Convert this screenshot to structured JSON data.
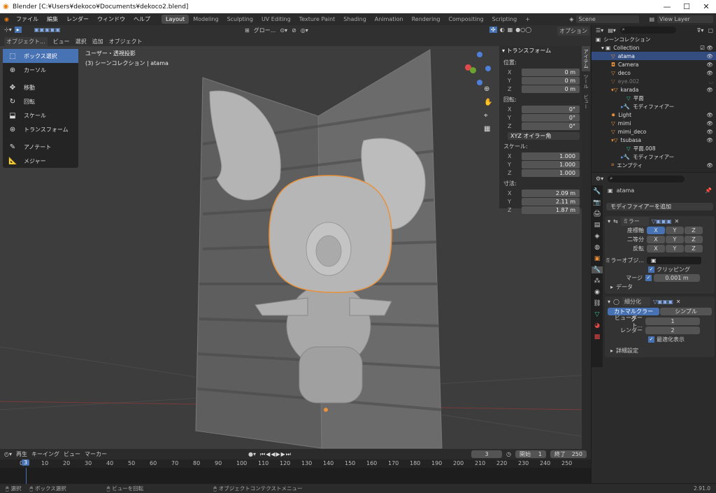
{
  "window": {
    "title": "Blender [C:¥Users¥dekoco¥Documents¥dekoco2.blend]"
  },
  "menus": [
    "ファイル",
    "編集",
    "レンダー",
    "ウィンドウ",
    "ヘルプ"
  ],
  "workspaces": [
    "Layout",
    "Modeling",
    "Sculpting",
    "UV Editing",
    "Texture Paint",
    "Shading",
    "Animation",
    "Rendering",
    "Compositing",
    "Scripting"
  ],
  "scene": "Scene",
  "view_layer": "View Layer",
  "viewport": {
    "mode": "オブジェクト...",
    "menus": [
      "ビュー",
      "選択",
      "追加",
      "オブジェクト"
    ],
    "overlay_line1": "ユーザー・透視投影",
    "overlay_line2": "(3) シーンコレクション | atama",
    "transform_orient": "グロー...",
    "options": "オプション"
  },
  "tools": [
    "ボックス選択",
    "カーソル",
    "移動",
    "回転",
    "スケール",
    "トランスフォーム",
    "アノテート",
    "メジャー"
  ],
  "npanel": {
    "title": "トランスフォーム",
    "loc_label": "位置:",
    "loc": [
      "0 m",
      "0 m",
      "0 m"
    ],
    "rot_label": "回転:",
    "rot": [
      "0°",
      "0°",
      "0°"
    ],
    "rot_mode": "XYZ オイラー角",
    "scale_label": "スケール:",
    "scale": [
      "1.000",
      "1.000",
      "1.000"
    ],
    "dim_label": "寸法:",
    "dim": [
      "2.09 m",
      "2.11 m",
      "1.87 m"
    ],
    "axes": [
      "X",
      "Y",
      "Z"
    ],
    "tabs": [
      "アイテム",
      "ツール",
      "ビュー"
    ]
  },
  "outliner": {
    "root": "シーンコレクション",
    "items": [
      "Collection",
      "atama",
      "Camera",
      "deco",
      "eye.002",
      "karada",
      "平面",
      "モディファイアー",
      "Light",
      "mimi",
      "mimi_deco",
      "tsubasa",
      "平面.008",
      "モディファイアー",
      "エンプティ"
    ]
  },
  "properties": {
    "object": "atama",
    "add_modifier": "モディファイアーを追加",
    "mirror": {
      "name": "ミラー",
      "axis_label": "座標軸",
      "bisect_label": "二等分",
      "flip_label": "反転",
      "xyz": [
        "X",
        "Y",
        "Z"
      ],
      "mirror_obj": "ミラーオブジ...",
      "clipping": "クリッピング",
      "merge_label": "マージ",
      "merge_value": "0.001 m",
      "data": "データ"
    },
    "subdiv": {
      "name": "細分化",
      "tab1": "カトマルクラーク",
      "tab2": "シンプル",
      "viewport_label": "ビューポート...",
      "viewport_value": "1",
      "render_label": "レンダー",
      "render_value": "2",
      "optimal": "最適化表示",
      "advanced": "詳細設定"
    }
  },
  "timeline": {
    "menus": [
      "再生",
      "キーイング",
      "ビュー",
      "マーカー"
    ],
    "current": "3",
    "start_label": "開始",
    "start": "1",
    "end_label": "終了",
    "end": "250",
    "ticks": [
      "0",
      "10",
      "20",
      "30",
      "40",
      "50",
      "60",
      "70",
      "80",
      "90",
      "100",
      "110",
      "120",
      "130",
      "140",
      "150",
      "160",
      "170",
      "180",
      "190",
      "200",
      "210",
      "220",
      "230",
      "240",
      "250"
    ]
  },
  "status": {
    "select": "選択",
    "box": "ボックス選択",
    "rotate": "ビューを回転",
    "context": "オブジェクトコンテクストメニュー",
    "version": "2.91.0"
  }
}
